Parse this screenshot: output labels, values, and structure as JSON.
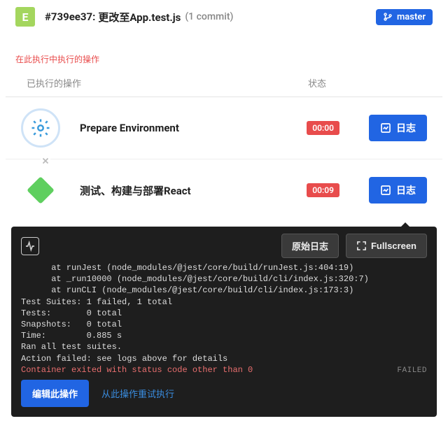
{
  "header": {
    "avatar_letter": "E",
    "commit_hash": "#739ee37:",
    "commit_msg": "更改至App.test.js",
    "commit_count": "(1 commit)",
    "branch": "master"
  },
  "section_label": "在此执行中执行的操作",
  "table": {
    "col_op": "已执行的操作",
    "col_status": "状态"
  },
  "rows": [
    {
      "title": "Prepare Environment",
      "time": "00:00",
      "log_btn": "日志"
    },
    {
      "title": "测试、构建与部署React",
      "time": "00:09",
      "log_btn": "日志"
    }
  ],
  "console": {
    "raw_log_btn": "原始日志",
    "fullscreen_btn": "Fullscreen",
    "lines_plain": "      at runJest (node_modules/@jest/core/build/runJest.js:404:19)\n      at _run10000 (node_modules/@jest/core/build/cli/index.js:320:7)\n      at runCLI (node_modules/@jest/core/build/cli/index.js:173:3)\nTest Suites: 1 failed, 1 total\nTests:       0 total\nSnapshots:   0 total\nTime:        0.885 s\nRan all test suites.\nAction failed: see logs above for details",
    "error_line": "Container exited with status code other than 0",
    "failed_tag": "FAILED"
  },
  "footer": {
    "edit_btn": "编辑此操作",
    "retry_btn": "从此操作重试执行"
  }
}
